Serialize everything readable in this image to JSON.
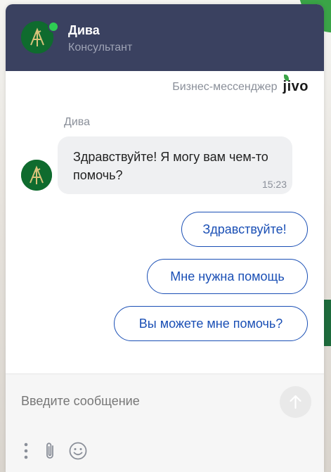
{
  "header": {
    "agent_name": "Дива",
    "agent_role": "Консультант",
    "status": "online"
  },
  "branding": {
    "text": "Бизнес-мессенджер",
    "logo": "jivo"
  },
  "conversation": {
    "sender_name": "Дива",
    "message_text": "Здравствуйте! Я могу вам чем-то помочь?",
    "message_time": "15:23"
  },
  "quick_replies": [
    "Здравствуйте!",
    "Мне нужна помощь",
    "Вы можете мне помочь?"
  ],
  "composer": {
    "placeholder": "Введите сообщение",
    "icons": [
      "menu-dots-icon",
      "paperclip-icon",
      "emoji-icon",
      "send-arrow-icon"
    ]
  },
  "colors": {
    "header_bg": "#3a4160",
    "accent_blue": "#1a4fb5",
    "online_green": "#2ecc53",
    "avatar_green": "#0f6b2e"
  }
}
